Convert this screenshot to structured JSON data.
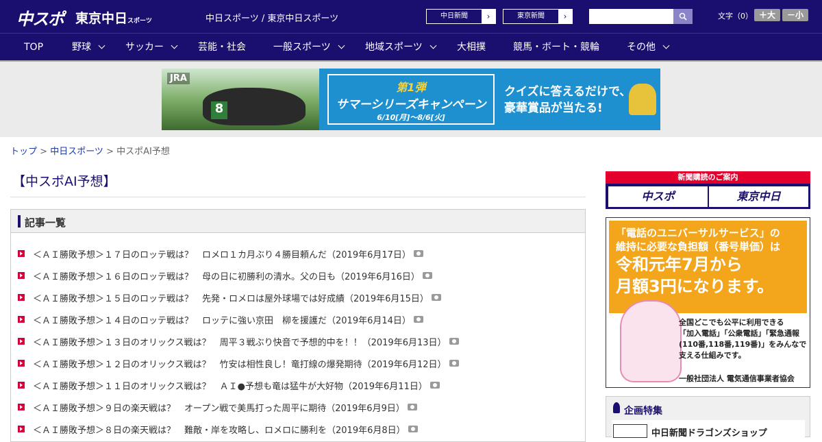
{
  "header": {
    "logo_chuspo": "中スポ",
    "logo_tokyo": "東京中日",
    "logo_tokyo_small": "スポーツ",
    "site_links": "中日スポーツ / 東京中日スポーツ",
    "paper_buttons": [
      {
        "label": "中日新聞",
        "arrow": "›"
      },
      {
        "label": "東京新聞",
        "arrow": "›"
      }
    ],
    "search": {
      "placeholder": "",
      "button_icon": "search-icon"
    },
    "font_size": {
      "label": "文字（0）",
      "larger": "＋大",
      "smaller": "－小"
    }
  },
  "nav": {
    "items": [
      {
        "label": "TOP",
        "dropdown": false
      },
      {
        "label": "野球",
        "dropdown": true
      },
      {
        "label": "サッカー",
        "dropdown": true
      },
      {
        "label": "芸能・社会",
        "dropdown": false
      },
      {
        "label": "一般スポーツ",
        "dropdown": true
      },
      {
        "label": "地域スポーツ",
        "dropdown": true
      },
      {
        "label": "大相撲",
        "dropdown": false
      },
      {
        "label": "競馬・ボート・競輪",
        "dropdown": false
      },
      {
        "label": "その他",
        "dropdown": true
      }
    ]
  },
  "banner": {
    "brand": "JRA",
    "number": "8",
    "campaign_no": "第1弾",
    "campaign_title": "サマーシリーズキャンペーン",
    "campaign_dates": "6/10[月]～8/6[火]",
    "copy_line1": "クイズに答えるだけで、",
    "copy_line2": "豪華賞品が当たる!"
  },
  "breadcrumb": {
    "top": "トップ",
    "sep": " > ",
    "chunichi": "中日スポーツ",
    "current": "中スポAI予想"
  },
  "page_title": "【中スポAI予想】",
  "article_list": {
    "heading": "記事一覧",
    "items": [
      "＜ＡＩ勝敗予想＞１７日のロッテ戦は？　ロメロ１カ月ぶり４勝目頼んだ（2019年6月17日）",
      "＜ＡＩ勝敗予想＞１６日のロッテ戦は？　母の日に初勝利の清水。父の日も（2019年6月16日）",
      "＜ＡＩ勝敗予想＞１５日のロッテ戦は？　先発・ロメロは屋外球場では好成績（2019年6月15日）",
      "＜ＡＩ勝敗予想＞１４日のロッテ戦は？　ロッテに強い京田　柳を援護だ（2019年6月14日）",
      "＜ＡＩ勝敗予想＞１３日のオリックス戦は？　周平３戦ぶり快音で予想的中を！！（2019年6月13日）",
      "＜ＡＩ勝敗予想＞１２日のオリックス戦は？　竹安は相性良し！竜打線の爆発期待（2019年6月12日）",
      "＜ＡＩ勝敗予想＞１１日のオリックス戦は？　ＡＩ●予想も竜は猛牛が大好物（2019年6月11日）",
      "＜ＡＩ勝敗予想＞９日の楽天戦は？　オープン戦で美馬打った周平に期待（2019年6月9日）",
      "＜ＡＩ勝敗予想＞８日の楽天戦は？　難敵・岸を攻略し、ロメロに勝利を（2019年6月8日）"
    ]
  },
  "sidebar": {
    "subscribe_heading": "新聞購読のご案内",
    "subscribe_chuspo": "中スポ",
    "subscribe_tokyo": "東京中日",
    "ad_line1": "「電話のユニバーサルサービス」の",
    "ad_line2": "維持に必要な負担額（番号単価）は",
    "ad_line3": "令和元年7月から",
    "ad_line4": "月額3円になります。",
    "ad_body1": "全国どこでも公平に利用できる",
    "ad_body2": "「加入電話」「公衆電話」「緊急通報",
    "ad_body3": "(110番,118番,119番)」をみんなで",
    "ad_body4": "支える仕組みです。",
    "ad_org": "一般社団法人 電気通信事業者協会",
    "feature_heading": "企画特集",
    "feature_item": "中日新聞ドラゴンズショップ"
  },
  "colors": {
    "navy": "#1a0f6e",
    "accent_red": "#d6003a",
    "link": "#1a3aa8"
  }
}
